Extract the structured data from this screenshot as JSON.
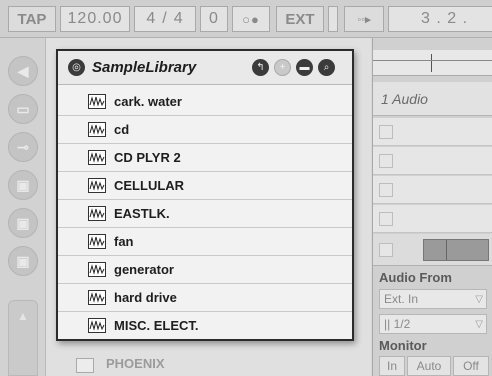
{
  "transport": {
    "tap": "TAP",
    "tempo": "120.00",
    "sig_num": "4",
    "sig_sep": "/",
    "sig_den": "4",
    "zero": "0",
    "metro": "○●",
    "ext": "EXT",
    "quant": "◦◦▸",
    "position": "3 .   2 ."
  },
  "library": {
    "title": "SampleLibrary",
    "items": [
      "cark. water",
      "cd",
      "CD PLYR 2",
      "CELLULAR",
      "EASTLK.",
      "fan",
      "generator",
      "hard drive",
      "MISC. ELECT."
    ]
  },
  "background_list": {
    "item_after": "PHOENIX"
  },
  "track": {
    "name": "1 Audio",
    "audio_from_label": "Audio From",
    "audio_from_value": "Ext. In",
    "channel_value": "|| 1/2",
    "monitor_label": "Monitor",
    "monitor_in": "In",
    "monitor_auto": "Auto",
    "monitor_off": "Off"
  },
  "colors": {
    "panel_border": "#2b2b2b",
    "text_dark": "#1e1e1e",
    "text_dim": "#8a8a8a"
  }
}
